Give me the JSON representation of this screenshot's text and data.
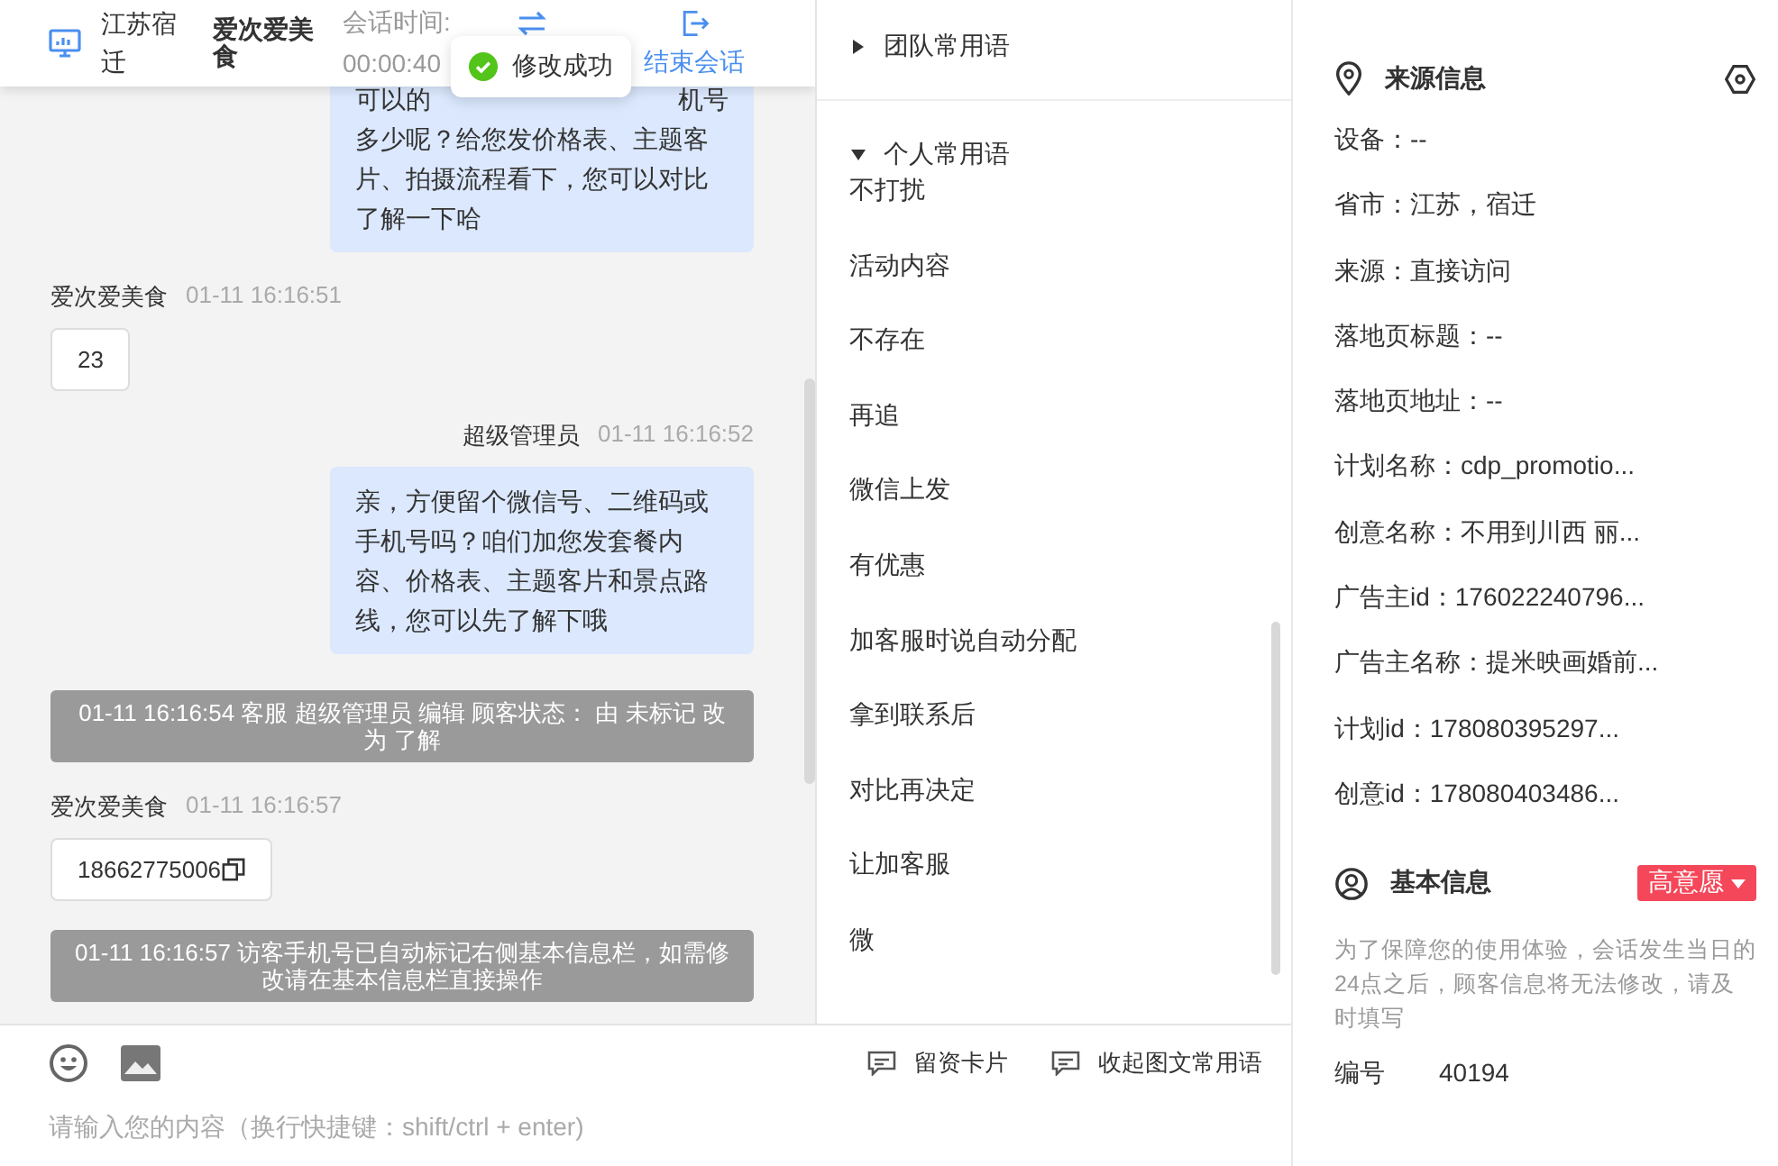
{
  "header": {
    "location": "江苏宿迁",
    "customer": "爱次爱美食",
    "session_label": "会话时间:",
    "session_time": "00:00:40",
    "end_label": "结束会话"
  },
  "toast": {
    "text": "修改成功"
  },
  "messages": [
    {
      "kind": "agent",
      "lines": [
        "可以的",
        "机号",
        "多少呢？给您发价格表、主题客片、拍摄流程看下，您可以对比了解一下哈"
      ]
    },
    {
      "kind": "visitor",
      "sender": "爱次爱美食",
      "time": "01-11 16:16:51",
      "text": "23",
      "copyable": false
    },
    {
      "kind": "agent",
      "sender": "超级管理员",
      "time": "01-11 16:16:52",
      "lines": [
        "亲，方便留个微信号、二维码或手机号吗？咱们加您发套餐内容、价格表、主题客片和景点路线，您可以先了解下哦"
      ]
    },
    {
      "kind": "system",
      "text": "01-11 16:16:54 客服 超级管理员 编辑 顾客状态： 由 未标记 改为 了解"
    },
    {
      "kind": "visitor",
      "sender": "爱次爱美食",
      "time": "01-11 16:16:57",
      "text": "18662775006",
      "copyable": true
    },
    {
      "kind": "system",
      "text": "01-11 16:16:57 访客手机号已自动标记右侧基本信息栏，如需修改请在基本信息栏直接操作"
    }
  ],
  "phrases": {
    "groups": [
      {
        "title": "团队常用语",
        "expanded": false
      },
      {
        "title": "个人常用语",
        "expanded": true,
        "items": [
          "不打扰",
          "活动内容",
          "不存在",
          "再追",
          "微信上发",
          "有优惠",
          "加客服时说自动分配",
          "拿到联系后",
          "对比再决定",
          "让加客服",
          "微"
        ]
      }
    ]
  },
  "toolbar": {
    "buttons": [
      "留资卡片",
      "收起图文常用语"
    ],
    "placeholder": "请输入您的内容（换行快捷键：shift/ctrl + enter)"
  },
  "source": {
    "title": "来源信息",
    "fields": [
      "设备：--",
      "省市：江苏，宿迁",
      "来源：直接访问",
      "落地页标题：--",
      "落地页地址：--",
      "计划名称：cdp_promotio...",
      "创意名称：不用到川西 丽...",
      "广告主id：176022240796...",
      "广告主名称：提米映画婚前...",
      "计划id：178080395297...",
      "创意id：178080403486..."
    ]
  },
  "basic": {
    "title": "基本信息",
    "intent": "高意愿",
    "notice": "为了保障您的使用体验，会话发生当日的24点之后，顾客信息将无法修改，请及时填写",
    "fields": [
      {
        "label": "编号",
        "value": "40194"
      }
    ]
  }
}
